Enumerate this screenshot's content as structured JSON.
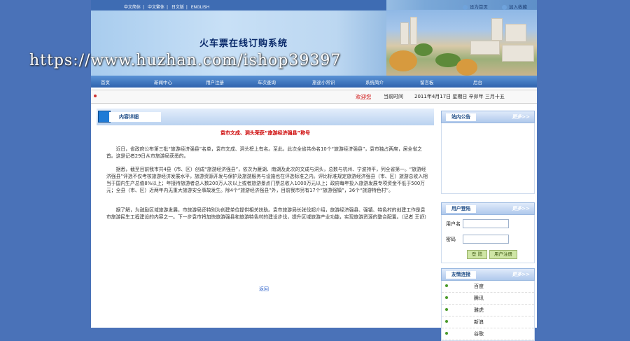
{
  "header": {
    "languages": [
      "中文简体",
      "中文繁体",
      "日文版",
      "ENGLISH"
    ],
    "top_links": [
      "设为首页",
      "加入收藏"
    ],
    "site_title": "火车票在线订购系统",
    "watermark": "https://www.huzhan.com/ishop39397"
  },
  "nav": {
    "items": [
      "首页",
      "新闻中心",
      "用户注册",
      "车次查询",
      "旅途小常识",
      "系统简介",
      "留言板",
      "后台"
    ]
  },
  "info_bar": {
    "welcome": "欢迎您",
    "time_label": "当前时间",
    "time_value": "2011年4月17日 星期日 辛卯年 三月十五"
  },
  "content": {
    "tab_label": "内容详细",
    "article_title": "袁市文成、洞头荣获“旅游经济强县”称号",
    "paragraphs": [
      "近日，省政府公布第三批“旅游经济强县”名单，袁市文成、洞头榜上有名。至此，此次全省共命名10个“旅游经济强县”，袁市独占两席，居全省之首。这是记者29日从市旅游局获悉的。",
      "据悉，截至目前我市共4县（市、区）创成“旅游经济强县”，依次为雁湖、南湖及此次的文成与洞头，总数与杭州、宁波持平，列全省第一。“旅游经济强县”评选不仅考核旅游经济发展水平，旅游资源开发与保护及旅游服务与设施也在评选标准之内。评比标准规定旅游经济强县（市、区）旅游总收入相当于国内生产总值8%以上；年接待旅游者总人数200万人次以上或者旅游景点门票总收入1000万元以上；政府每年投入旅游发展专项资金不低于500万元；全县（市、区）近两年内无重大旅游安全事故发生。除4个“旅游经济强县”外，目前我市另有17个“旅游强镇”，36个“旅游特色村”。",
      "据了解，为鼓励区域旅游发展，市旅游局还特别为创建单位提供相关扶助。袁市旅游局长张伐超介绍，旅游经济强县、强镇、特色村的创建工作是袁市旅游民生工程建设的内容之一。下一步袁市将加快旅游强县和旅游特色村的建设步伐，提升区域旅游产业功能，实现旅游资源的整合配置。（记者 王舒）"
    ],
    "back_link": "返回"
  },
  "sidebar": {
    "notice": {
      "title": "站内公告",
      "more": "更多>>"
    },
    "login": {
      "title": "用户登陆",
      "more": "更多>>",
      "username_label": "用户名",
      "password_label": "密码",
      "login_button": "登 陆",
      "register_button": "用户注册"
    },
    "links": {
      "title": "友情连接",
      "more": "更多>>",
      "items": [
        "百度",
        "腾讯",
        "雅虎",
        "新浪",
        "谷歌"
      ]
    }
  }
}
